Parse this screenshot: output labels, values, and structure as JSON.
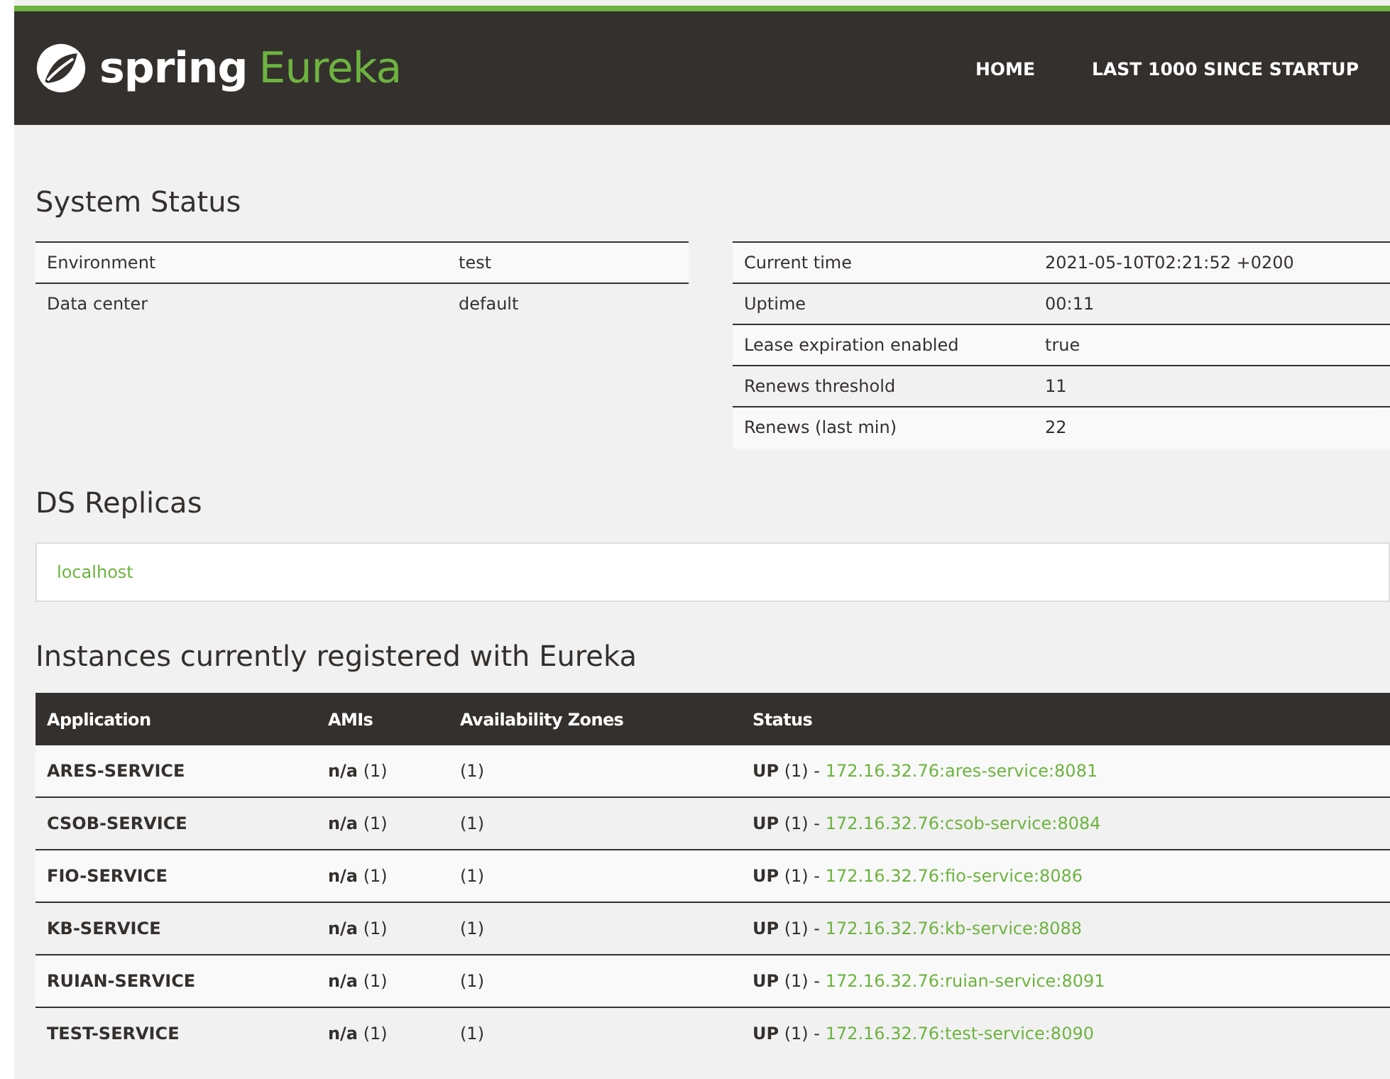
{
  "header": {
    "brand": "spring",
    "product": "Eureka",
    "nav": [
      {
        "label": "HOME"
      },
      {
        "label": "LAST 1000 SINCE STARTUP"
      }
    ]
  },
  "system_status": {
    "title": "System Status",
    "left": [
      {
        "label": "Environment",
        "value": "test"
      },
      {
        "label": "Data center",
        "value": "default"
      }
    ],
    "right": [
      {
        "label": "Current time",
        "value": "2021-05-10T02:21:52 +0200"
      },
      {
        "label": "Uptime",
        "value": "00:11"
      },
      {
        "label": "Lease expiration enabled",
        "value": "true"
      },
      {
        "label": "Renews threshold",
        "value": "11"
      },
      {
        "label": "Renews (last min)",
        "value": "22"
      }
    ]
  },
  "ds_replicas": {
    "title": "DS Replicas",
    "items": [
      "localhost"
    ]
  },
  "instances": {
    "title": "Instances currently registered with Eureka",
    "columns": [
      "Application",
      "AMIs",
      "Availability Zones",
      "Status"
    ],
    "rows": [
      {
        "application": "ARES-SERVICE",
        "amis": "**n/a** (1)",
        "zones": "(1)",
        "status": "**UP** (1) - ",
        "link": "172.16.32.76:ares-service:8081"
      },
      {
        "application": "CSOB-SERVICE",
        "amis": "**n/a** (1)",
        "zones": "(1)",
        "status": "**UP** (1) - ",
        "link": "172.16.32.76:csob-service:8084"
      },
      {
        "application": "FIO-SERVICE",
        "amis": "**n/a** (1)",
        "zones": "(1)",
        "status": "**UP** (1) - ",
        "link": "172.16.32.76:fio-service:8086"
      },
      {
        "application": "KB-SERVICE",
        "amis": "**n/a** (1)",
        "zones": "(1)",
        "status": "**UP** (1) - ",
        "link": "172.16.32.76:kb-service:8088"
      },
      {
        "application": "RUIAN-SERVICE",
        "amis": "**n/a** (1)",
        "zones": "(1)",
        "status": "**UP** (1) - ",
        "link": "172.16.32.76:ruian-service:8091"
      },
      {
        "application": "TEST-SERVICE",
        "amis": "**n/a** (1)",
        "zones": "(1)",
        "status": "**UP** (1) - ",
        "link": "172.16.32.76:test-service:8090"
      }
    ]
  }
}
